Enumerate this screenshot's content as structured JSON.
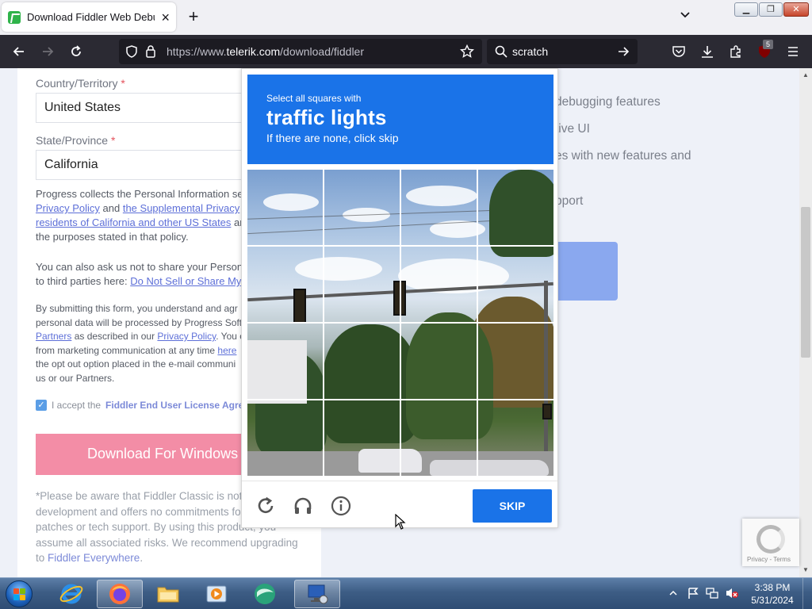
{
  "browser": {
    "tab_title": "Download Fiddler Web Debugg",
    "url_prefix": "https://www.",
    "url_domain": "telerik.com",
    "url_path": "/download/fiddler",
    "search_text": "scratch",
    "extension_badge": "5"
  },
  "form": {
    "country_label": "Country/Territory",
    "required_mark": "*",
    "country_value": "United States",
    "state_label": "State/Province",
    "state_value": "California",
    "privacy": {
      "line1": "Progress collects the Personal Information se",
      "link_policy": "Privacy Policy",
      "and": " and ",
      "link_supplemental": "the Supplemental Privacy",
      "link_residents": "residents of California and other US States",
      "tail": " an",
      "line4": "the purposes stated in that policy."
    },
    "share": {
      "line1": "You can also ask us not to share your Persona",
      "line2_prefix": "to third parties here: ",
      "link": "Do Not Sell or Share My"
    },
    "consent": {
      "line1": "By submitting this form, you understand and agr",
      "line2": "personal data will be processed by Progress Soft",
      "link_partners": "Partners",
      "line3_mid": " as described in our ",
      "link_privacy": "Privacy Policy",
      "line3_tail": ". You c",
      "line4_prefix": "from marketing communication at any time ",
      "link_here": "here",
      "line5": "the opt out option placed in the e-mail communi",
      "line6": "us or our Partners."
    },
    "accept_prefix": "I accept the ",
    "accept_link": "Fiddler End User License Agree",
    "download_button": "Download For Windows",
    "note": {
      "line1": "*Please be aware that Fiddler Classic is not",
      "line2": "development and offers no commitments fo",
      "line3": "patches or tech support. By using this product, you",
      "line4": "assume all associated risks. We recommend upgrading",
      "line5_prefix": "to ",
      "link": "Fiddler Everywhere",
      "line5_tail": "."
    }
  },
  "features": [
    "debugging features",
    "tive UI",
    "es with new features and",
    "pport"
  ],
  "captcha": {
    "pre": "Select all squares with",
    "target": "traffic lights",
    "sub": "If there are none, click skip",
    "skip": "SKIP"
  },
  "recaptcha": {
    "terms": "Privacy - Terms"
  },
  "taskbar": {
    "time": "3:38 PM",
    "date": "5/31/2024"
  },
  "colors": {
    "captcha_blue": "#1a73e8",
    "toolbar": "#2b2a33",
    "download_pink": "#f38da6"
  }
}
